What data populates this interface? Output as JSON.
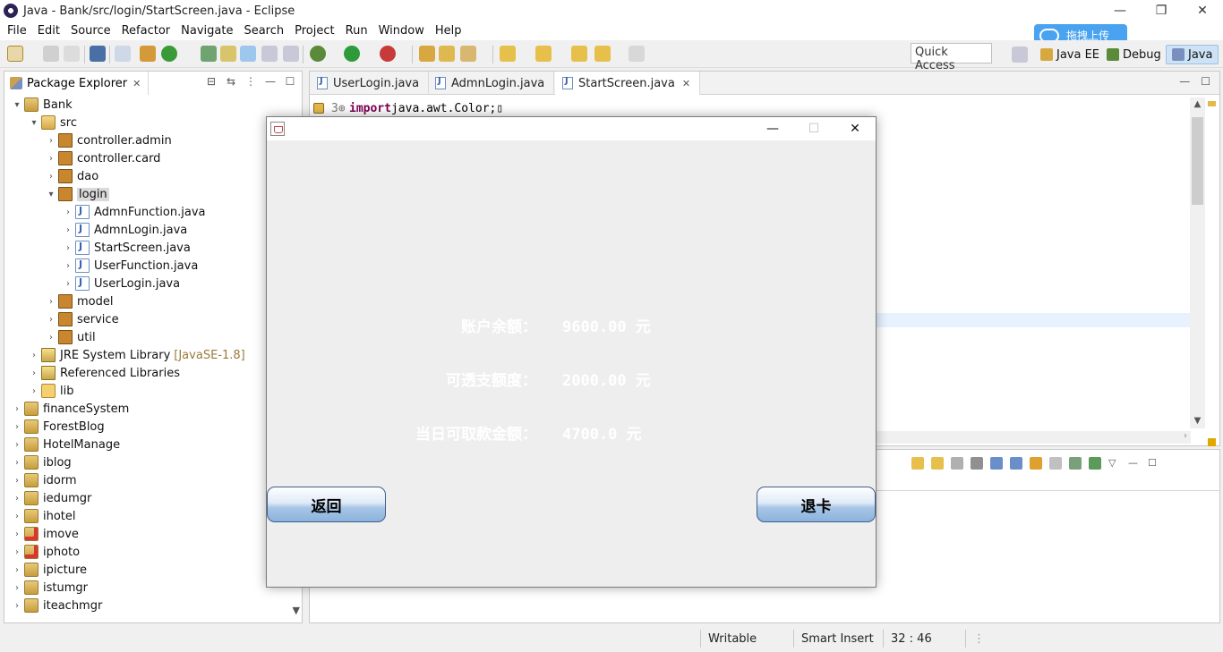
{
  "window": {
    "title": "Java - Bank/src/login/StartScreen.java - Eclipse",
    "minimize": "—",
    "restore": "❐",
    "close": "✕"
  },
  "menu": [
    "File",
    "Edit",
    "Source",
    "Refactor",
    "Navigate",
    "Search",
    "Project",
    "Run",
    "Window",
    "Help"
  ],
  "upload_badge": {
    "label": "拖拽上传",
    "color": "#4aa3f0"
  },
  "toolbar": {
    "quick_access": "Quick Access",
    "perspectives": [
      "Java EE",
      "Debug",
      "Java"
    ]
  },
  "package_explorer": {
    "title": "Package Explorer",
    "close": "✕",
    "tree": [
      {
        "label": "Bank",
        "icon": "project",
        "arrow": "▾",
        "level": 0
      },
      {
        "label": "src",
        "icon": "src",
        "arrow": "▾",
        "level": 1
      },
      {
        "label": "controller.admin",
        "icon": "package",
        "arrow": "›",
        "level": 2
      },
      {
        "label": "controller.card",
        "icon": "package",
        "arrow": "›",
        "level": 2
      },
      {
        "label": "dao",
        "icon": "package",
        "arrow": "›",
        "level": 2
      },
      {
        "label": "login",
        "icon": "package",
        "arrow": "▾",
        "level": 2,
        "selected": true
      },
      {
        "label": "AdmnFunction.java",
        "icon": "java",
        "arrow": "›",
        "level": 3
      },
      {
        "label": "AdmnLogin.java",
        "icon": "java",
        "arrow": "›",
        "level": 3
      },
      {
        "label": "StartScreen.java",
        "icon": "java",
        "arrow": "›",
        "level": 3
      },
      {
        "label": "UserFunction.java",
        "icon": "java",
        "arrow": "›",
        "level": 3
      },
      {
        "label": "UserLogin.java",
        "icon": "java",
        "arrow": "›",
        "level": 3
      },
      {
        "label": "model",
        "icon": "package",
        "arrow": "›",
        "level": 2
      },
      {
        "label": "service",
        "icon": "package",
        "arrow": "›",
        "level": 2
      },
      {
        "label": "util",
        "icon": "package",
        "arrow": "›",
        "level": 2
      },
      {
        "label": "JRE System Library",
        "icon": "library",
        "arrow": "›",
        "level": 1,
        "decoration": "[JavaSE-1.8]"
      },
      {
        "label": "Referenced Libraries",
        "icon": "library",
        "arrow": "›",
        "level": 1
      },
      {
        "label": "lib",
        "icon": "folder",
        "arrow": "›",
        "level": 1
      },
      {
        "label": "financeSystem",
        "icon": "project",
        "arrow": "›",
        "level": 0
      },
      {
        "label": "ForestBlog",
        "icon": "project",
        "arrow": "›",
        "level": 0
      },
      {
        "label": "HotelManage",
        "icon": "project",
        "arrow": "›",
        "level": 0
      },
      {
        "label": "iblog",
        "icon": "project",
        "arrow": "›",
        "level": 0
      },
      {
        "label": "idorm",
        "icon": "project",
        "arrow": "›",
        "level": 0
      },
      {
        "label": "iedumgr",
        "icon": "project",
        "arrow": "›",
        "level": 0
      },
      {
        "label": "ihotel",
        "icon": "project",
        "arrow": "›",
        "level": 0
      },
      {
        "label": "imove",
        "icon": "project-error",
        "arrow": "›",
        "level": 0
      },
      {
        "label": "iphoto",
        "icon": "project-error",
        "arrow": "›",
        "level": 0
      },
      {
        "label": "ipicture",
        "icon": "project",
        "arrow": "›",
        "level": 0
      },
      {
        "label": "istumgr",
        "icon": "project",
        "arrow": "›",
        "level": 0
      },
      {
        "label": "iteachmgr",
        "icon": "project",
        "arrow": "›",
        "level": 0
      }
    ]
  },
  "editor": {
    "tabs": [
      {
        "label": "UserLogin.java",
        "active": false
      },
      {
        "label": "AdmnLogin.java",
        "active": false
      },
      {
        "label": "StartScreen.java",
        "active": true,
        "close": "✕"
      }
    ],
    "line_number": "3⊕",
    "code_keyword": "import",
    "code_rest": " java.awt.Color;▯"
  },
  "status": {
    "writable": "Writable",
    "insert_mode": "Smart Insert",
    "position": "32 : 46"
  },
  "dialog": {
    "minimize": "—",
    "maximize": "☐",
    "close": "✕",
    "rows": [
      {
        "label": "账户余额：",
        "value": "9600.00 元"
      },
      {
        "label": "可透支额度：",
        "value": "2000.00 元"
      },
      {
        "label": "当日可取款金额：",
        "value": "4700.0 元"
      }
    ],
    "back_button": "返回",
    "eject_button": "退卡"
  }
}
